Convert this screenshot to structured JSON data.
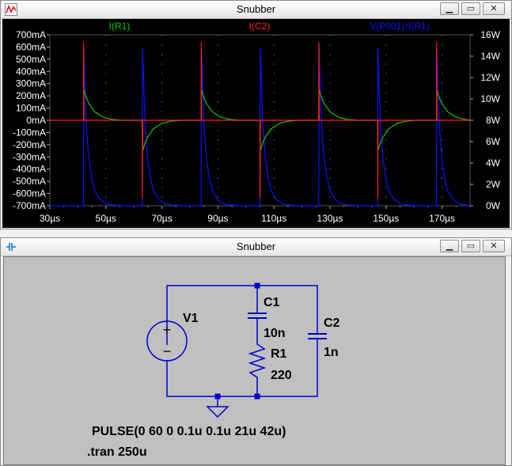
{
  "plot_window": {
    "title": "Snubber",
    "icon": "waveform-icon",
    "controls": {
      "minimize": "minimize-icon",
      "maximize": "maximize-icon",
      "close": "close-icon"
    }
  },
  "schematic_window": {
    "title": "Snubber",
    "icon": "schematic-icon",
    "controls": {
      "minimize": "minimize-icon",
      "maximize": "maximize-icon",
      "close": "close-icon"
    }
  },
  "colors": {
    "i_r1": "#00d000",
    "i_c2": "#ff2020",
    "power": "#1010ff",
    "wire": "#0000cc",
    "background": "#000000",
    "grid": "#555555"
  },
  "chart_data": {
    "type": "line",
    "xlabel": "",
    "xlim": [
      30,
      180
    ],
    "x_ticks": [
      "30µs",
      "50µs",
      "70µs",
      "90µs",
      "110µs",
      "130µs",
      "150µs",
      "170µs"
    ],
    "ylim_left": [
      -700,
      700
    ],
    "y_ticks_left": [
      "700mA",
      "600mA",
      "500mA",
      "400mA",
      "300mA",
      "200mA",
      "100mA",
      "0mA",
      "-100mA",
      "-200mA",
      "-300mA",
      "-400mA",
      "-500mA",
      "-600mA",
      "-700mA"
    ],
    "ylim_right": [
      0,
      16
    ],
    "y_ticks_right": [
      "16W",
      "14W",
      "12W",
      "10W",
      "8W",
      "6W",
      "4W",
      "2W",
      "0W"
    ],
    "series": [
      {
        "name": "I(R1)",
        "axis": "left",
        "color": "#00d000",
        "x": [
          42,
          42.1,
          43,
          44,
          46,
          49,
          52,
          56,
          63,
          63.1,
          64,
          65,
          67,
          70,
          73,
          77,
          84,
          84.1,
          85,
          86,
          88,
          91,
          94,
          98,
          105,
          105.1,
          106,
          107,
          109,
          112,
          115,
          119,
          126,
          126.1,
          127,
          128,
          130,
          133,
          136,
          140,
          147,
          147.1,
          148,
          149,
          151,
          154,
          157,
          161,
          168,
          168.1,
          169,
          170,
          172,
          175,
          178,
          180
        ],
        "y": [
          0,
          250,
          185,
          135,
          70,
          25,
          8,
          0,
          0,
          -250,
          -185,
          -135,
          -70,
          -25,
          -8,
          0,
          0,
          250,
          185,
          135,
          70,
          25,
          8,
          0,
          0,
          -250,
          -185,
          -135,
          -70,
          -25,
          -8,
          0,
          0,
          250,
          185,
          135,
          70,
          25,
          8,
          0,
          0,
          -250,
          -185,
          -135,
          -70,
          -25,
          -8,
          0,
          0,
          250,
          185,
          135,
          70,
          25,
          8,
          0
        ]
      },
      {
        "name": "I(C2)",
        "axis": "left",
        "color": "#ff2020",
        "x": [
          30,
          42,
          42.05,
          42.15,
          63,
          63.05,
          63.15,
          84,
          84.05,
          84.15,
          105,
          105.05,
          105.15,
          126,
          126.05,
          126.15,
          147,
          147.05,
          147.15,
          168,
          168.05,
          168.15,
          180
        ],
        "y": [
          0,
          0,
          640,
          0,
          0,
          -640,
          0,
          0,
          640,
          0,
          0,
          -640,
          0,
          0,
          640,
          0,
          0,
          -640,
          0,
          0,
          640,
          0,
          0
        ]
      },
      {
        "name": "V(P001)*I(R1)",
        "axis": "right",
        "color": "#1010ff",
        "x": [
          30,
          42,
          42.1,
          43,
          44,
          45,
          46,
          48,
          50,
          52,
          56,
          63,
          63.1,
          64,
          65,
          66,
          67,
          69,
          71,
          73,
          77,
          84,
          84.1,
          85,
          86,
          87,
          88,
          90,
          92,
          94,
          98,
          105,
          105.1,
          106,
          107,
          108,
          109,
          111,
          113,
          115,
          119,
          126,
          126.1,
          127,
          128,
          129,
          130,
          132,
          134,
          136,
          140,
          147,
          147.1,
          148,
          149,
          150,
          151,
          153,
          155,
          157,
          161,
          168,
          168.1,
          169,
          170,
          171,
          172,
          174,
          176,
          178,
          180
        ],
        "y": [
          0,
          0,
          14.8,
          7.5,
          4.2,
          2.5,
          1.4,
          0.55,
          0.2,
          0.08,
          0,
          0,
          14.8,
          7.5,
          4.2,
          2.5,
          1.4,
          0.55,
          0.2,
          0.08,
          0,
          0,
          14.8,
          7.5,
          4.2,
          2.5,
          1.4,
          0.55,
          0.2,
          0.08,
          0,
          0,
          14.8,
          7.5,
          4.2,
          2.5,
          1.4,
          0.55,
          0.2,
          0.08,
          0,
          0,
          14.8,
          7.5,
          4.2,
          2.5,
          1.4,
          0.55,
          0.2,
          0.08,
          0,
          0,
          14.8,
          7.5,
          4.2,
          2.5,
          1.4,
          0.55,
          0.2,
          0.08,
          0,
          0,
          14.8,
          7.5,
          4.2,
          2.5,
          1.4,
          0.55,
          0.2,
          0.08,
          0
        ]
      }
    ]
  },
  "schematic": {
    "v1_label": "V1",
    "c1_label": "C1",
    "c1_value": "10n",
    "r1_label": "R1",
    "r1_value": "220",
    "c2_label": "C2",
    "c2_value": "1n",
    "pulse_directive": "PULSE(0 60 0 0.1u 0.1u 21u 42u)",
    "tran_directive": ".tran 250u",
    "plus_sign": "+",
    "minus_sign": "−"
  }
}
